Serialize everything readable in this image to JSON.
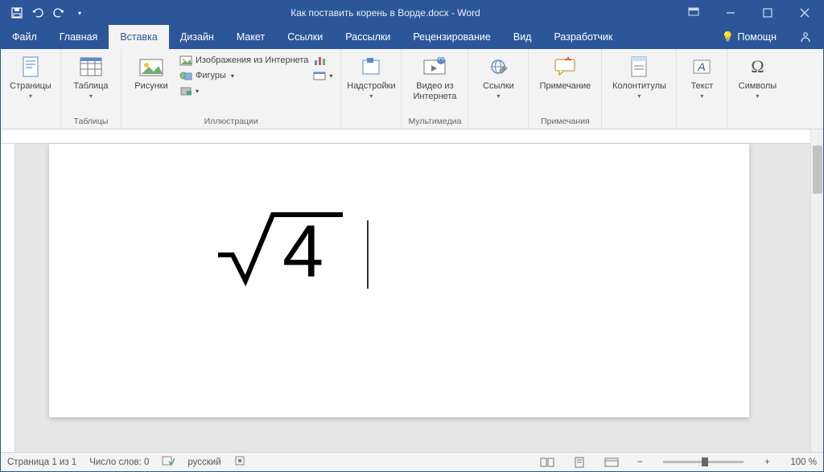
{
  "titlebar": {
    "title": "Как поставить корень в Ворде.docx - Word"
  },
  "tabs": {
    "file": "Файл",
    "home": "Главная",
    "insert": "Вставка",
    "design": "Дизайн",
    "layout": "Макет",
    "references": "Ссылки",
    "mailings": "Рассылки",
    "review": "Рецензирование",
    "view": "Вид",
    "developer": "Разработчик",
    "help": "Помощн"
  },
  "ribbon": {
    "pages": {
      "label": "Страницы",
      "group": ""
    },
    "table": {
      "label": "Таблица",
      "group": "Таблицы"
    },
    "pictures": {
      "label": "Рисунки"
    },
    "online_pictures": "Изображения из Интернета",
    "shapes": "Фигуры",
    "illustrations_group": "Иллюстрации",
    "addins": {
      "label": "Надстройки"
    },
    "online_video": {
      "label": "Видео из Интернета",
      "group": "Мультимедиа"
    },
    "links": {
      "label": "Ссылки"
    },
    "comment": {
      "label": "Примечание",
      "group": "Примечания"
    },
    "headerfooter": {
      "label": "Колонтитулы"
    },
    "text": {
      "label": "Текст"
    },
    "symbols": {
      "label": "Символы"
    }
  },
  "document": {
    "equation": "√4"
  },
  "status": {
    "page": "Страница 1 из 1",
    "words": "Число слов: 0",
    "language": "русский",
    "zoom": "100 %",
    "minus": "−",
    "plus": "+"
  }
}
